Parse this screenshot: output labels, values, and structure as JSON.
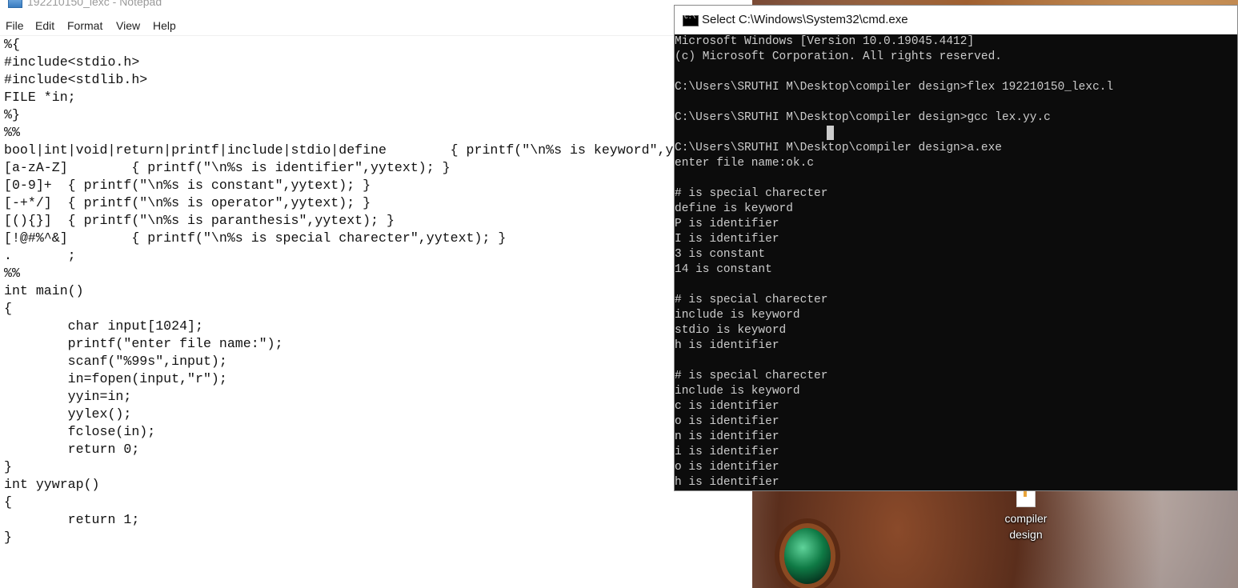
{
  "notepad": {
    "title": "192210150_lexc - Notepad",
    "menu": [
      "File",
      "Edit",
      "Format",
      "View",
      "Help"
    ],
    "content": "%{\n#include<stdio.h>\n#include<stdlib.h>\nFILE *in;\n%}\n%%\nbool|int|void|return|printf|include|stdio|define        { printf(\"\\n%s is keyword\",y\n[a-zA-Z]        { printf(\"\\n%s is identifier\",yytext); }\n[0-9]+  { printf(\"\\n%s is constant\",yytext); }\n[-+*/]  { printf(\"\\n%s is operator\",yytext); }\n[(){}]  { printf(\"\\n%s is paranthesis\",yytext); }\n[!@#%^&]        { printf(\"\\n%s is special charecter\",yytext); }\n.       ;\n%%\nint main()\n{\n        char input[1024];\n        printf(\"enter file name:\");\n        scanf(\"%99s\",input);\n        in=fopen(input,\"r\");\n        yyin=in;\n        yylex();\n        fclose(in);\n        return 0;\n}\nint yywrap()\n{\n        return 1;\n}"
  },
  "cmd": {
    "title": "Select C:\\Windows\\System32\\cmd.exe",
    "output": "Microsoft Windows [Version 10.0.19045.4412]\n(c) Microsoft Corporation. All rights reserved.\n\nC:\\Users\\SRUTHI M\\Desktop\\compiler design>flex 192210150_lexc.l\n\nC:\\Users\\SRUTHI M\\Desktop\\compiler design>gcc lex.yy.c\n\nC:\\Users\\SRUTHI M\\Desktop\\compiler design>a.exe\nenter file name:ok.c\n\n# is special charecter\ndefine is keyword\nP is identifier\nI is identifier\n3 is constant\n14 is constant\n\n# is special charecter\ninclude is keyword\nstdio is keyword\nh is identifier\n\n# is special charecter\ninclude is keyword\nc is identifier\no is identifier\nn is identifier\ni is identifier\no is identifier\nh is identifier"
  },
  "desktop": {
    "icon_label_line1": "compiler",
    "icon_label_line2": "design"
  }
}
